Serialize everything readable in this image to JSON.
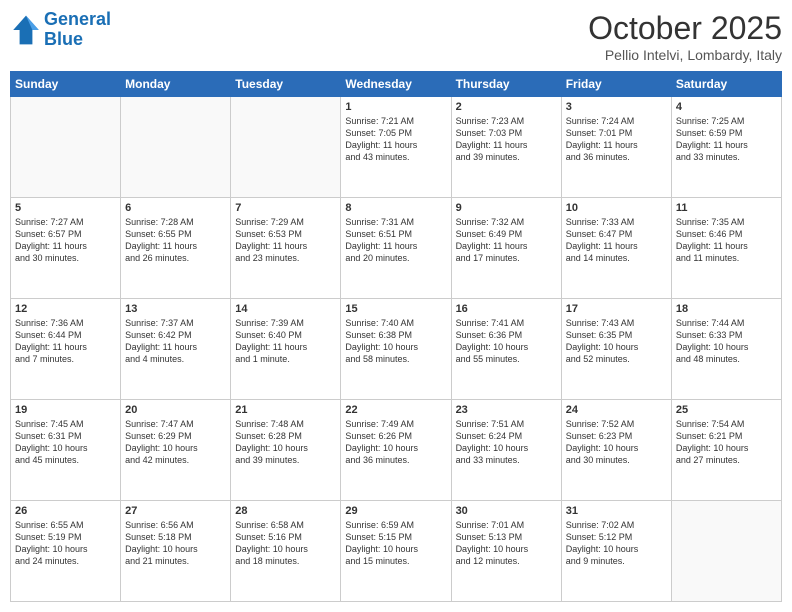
{
  "header": {
    "logo_line1": "General",
    "logo_line2": "Blue",
    "title": "October 2025",
    "subtitle": "Pellio Intelvi, Lombardy, Italy"
  },
  "weekdays": [
    "Sunday",
    "Monday",
    "Tuesday",
    "Wednesday",
    "Thursday",
    "Friday",
    "Saturday"
  ],
  "weeks": [
    [
      {
        "day": "",
        "info": ""
      },
      {
        "day": "",
        "info": ""
      },
      {
        "day": "",
        "info": ""
      },
      {
        "day": "1",
        "info": "Sunrise: 7:21 AM\nSunset: 7:05 PM\nDaylight: 11 hours\nand 43 minutes."
      },
      {
        "day": "2",
        "info": "Sunrise: 7:23 AM\nSunset: 7:03 PM\nDaylight: 11 hours\nand 39 minutes."
      },
      {
        "day": "3",
        "info": "Sunrise: 7:24 AM\nSunset: 7:01 PM\nDaylight: 11 hours\nand 36 minutes."
      },
      {
        "day": "4",
        "info": "Sunrise: 7:25 AM\nSunset: 6:59 PM\nDaylight: 11 hours\nand 33 minutes."
      }
    ],
    [
      {
        "day": "5",
        "info": "Sunrise: 7:27 AM\nSunset: 6:57 PM\nDaylight: 11 hours\nand 30 minutes."
      },
      {
        "day": "6",
        "info": "Sunrise: 7:28 AM\nSunset: 6:55 PM\nDaylight: 11 hours\nand 26 minutes."
      },
      {
        "day": "7",
        "info": "Sunrise: 7:29 AM\nSunset: 6:53 PM\nDaylight: 11 hours\nand 23 minutes."
      },
      {
        "day": "8",
        "info": "Sunrise: 7:31 AM\nSunset: 6:51 PM\nDaylight: 11 hours\nand 20 minutes."
      },
      {
        "day": "9",
        "info": "Sunrise: 7:32 AM\nSunset: 6:49 PM\nDaylight: 11 hours\nand 17 minutes."
      },
      {
        "day": "10",
        "info": "Sunrise: 7:33 AM\nSunset: 6:47 PM\nDaylight: 11 hours\nand 14 minutes."
      },
      {
        "day": "11",
        "info": "Sunrise: 7:35 AM\nSunset: 6:46 PM\nDaylight: 11 hours\nand 11 minutes."
      }
    ],
    [
      {
        "day": "12",
        "info": "Sunrise: 7:36 AM\nSunset: 6:44 PM\nDaylight: 11 hours\nand 7 minutes."
      },
      {
        "day": "13",
        "info": "Sunrise: 7:37 AM\nSunset: 6:42 PM\nDaylight: 11 hours\nand 4 minutes."
      },
      {
        "day": "14",
        "info": "Sunrise: 7:39 AM\nSunset: 6:40 PM\nDaylight: 11 hours\nand 1 minute."
      },
      {
        "day": "15",
        "info": "Sunrise: 7:40 AM\nSunset: 6:38 PM\nDaylight: 10 hours\nand 58 minutes."
      },
      {
        "day": "16",
        "info": "Sunrise: 7:41 AM\nSunset: 6:36 PM\nDaylight: 10 hours\nand 55 minutes."
      },
      {
        "day": "17",
        "info": "Sunrise: 7:43 AM\nSunset: 6:35 PM\nDaylight: 10 hours\nand 52 minutes."
      },
      {
        "day": "18",
        "info": "Sunrise: 7:44 AM\nSunset: 6:33 PM\nDaylight: 10 hours\nand 48 minutes."
      }
    ],
    [
      {
        "day": "19",
        "info": "Sunrise: 7:45 AM\nSunset: 6:31 PM\nDaylight: 10 hours\nand 45 minutes."
      },
      {
        "day": "20",
        "info": "Sunrise: 7:47 AM\nSunset: 6:29 PM\nDaylight: 10 hours\nand 42 minutes."
      },
      {
        "day": "21",
        "info": "Sunrise: 7:48 AM\nSunset: 6:28 PM\nDaylight: 10 hours\nand 39 minutes."
      },
      {
        "day": "22",
        "info": "Sunrise: 7:49 AM\nSunset: 6:26 PM\nDaylight: 10 hours\nand 36 minutes."
      },
      {
        "day": "23",
        "info": "Sunrise: 7:51 AM\nSunset: 6:24 PM\nDaylight: 10 hours\nand 33 minutes."
      },
      {
        "day": "24",
        "info": "Sunrise: 7:52 AM\nSunset: 6:23 PM\nDaylight: 10 hours\nand 30 minutes."
      },
      {
        "day": "25",
        "info": "Sunrise: 7:54 AM\nSunset: 6:21 PM\nDaylight: 10 hours\nand 27 minutes."
      }
    ],
    [
      {
        "day": "26",
        "info": "Sunrise: 6:55 AM\nSunset: 5:19 PM\nDaylight: 10 hours\nand 24 minutes."
      },
      {
        "day": "27",
        "info": "Sunrise: 6:56 AM\nSunset: 5:18 PM\nDaylight: 10 hours\nand 21 minutes."
      },
      {
        "day": "28",
        "info": "Sunrise: 6:58 AM\nSunset: 5:16 PM\nDaylight: 10 hours\nand 18 minutes."
      },
      {
        "day": "29",
        "info": "Sunrise: 6:59 AM\nSunset: 5:15 PM\nDaylight: 10 hours\nand 15 minutes."
      },
      {
        "day": "30",
        "info": "Sunrise: 7:01 AM\nSunset: 5:13 PM\nDaylight: 10 hours\nand 12 minutes."
      },
      {
        "day": "31",
        "info": "Sunrise: 7:02 AM\nSunset: 5:12 PM\nDaylight: 10 hours\nand 9 minutes."
      },
      {
        "day": "",
        "info": ""
      }
    ]
  ]
}
